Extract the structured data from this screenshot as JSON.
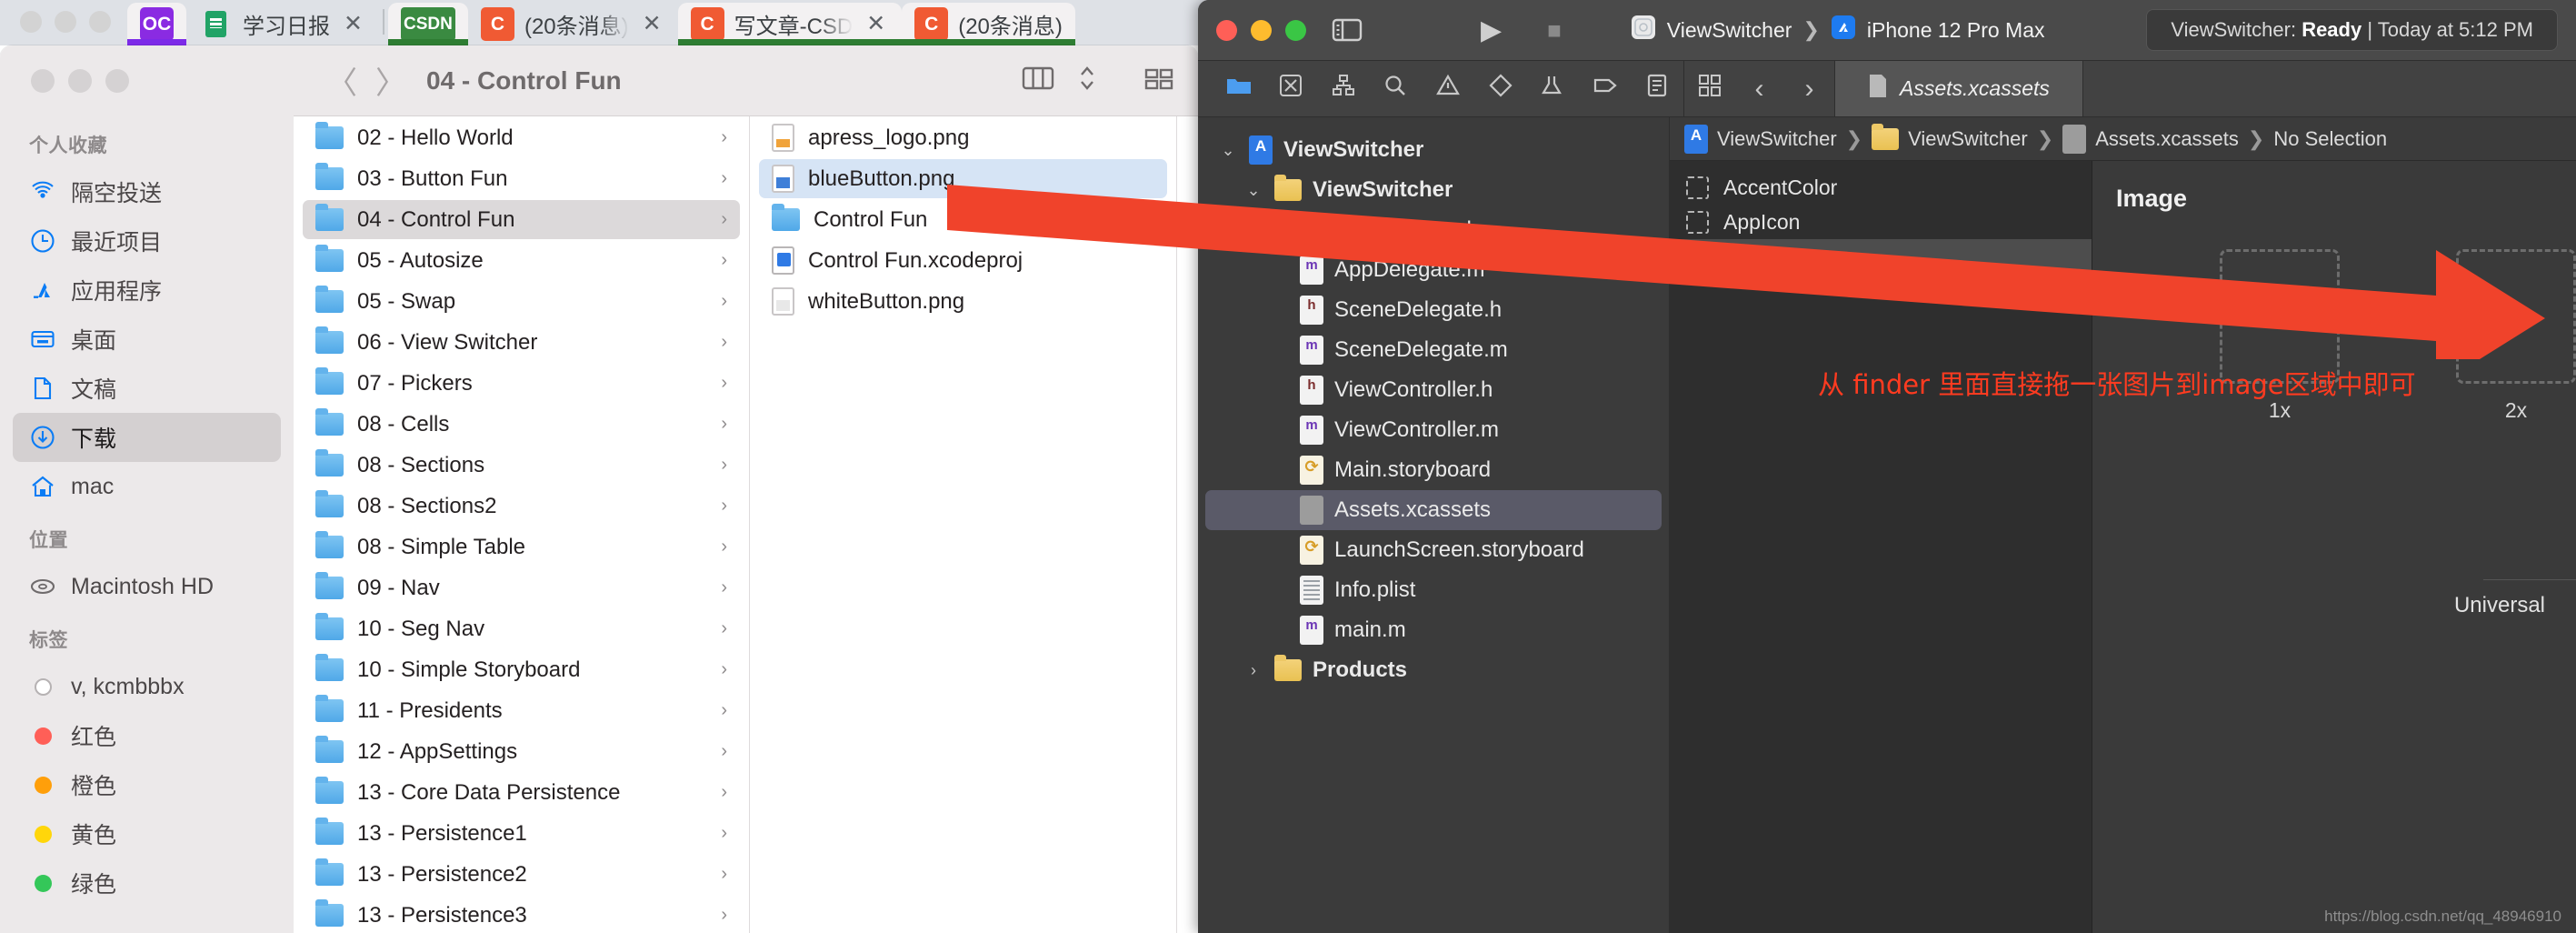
{
  "browser": {
    "window_dots": [
      "dot-red",
      "dot-yellow",
      "dot-green"
    ],
    "tabs": [
      {
        "favicon_text": "OC",
        "favicon_color": "#8a2be2",
        "title": "",
        "accent": "#7c2ae8",
        "active": true,
        "closable": false
      },
      {
        "favicon_text": "",
        "favicon_color": "#21a366",
        "title": "学习日报",
        "accent": "",
        "active": false,
        "closable": true
      },
      {
        "favicon_text": "CSDN",
        "favicon_color": "#3a8a41",
        "title": "",
        "accent": "#2e7d33",
        "active": true,
        "closable": false
      },
      {
        "favicon_text": "C",
        "favicon_color": "#f05a33",
        "title": "(20条消息)",
        "accent": "",
        "active": false,
        "closable": true
      },
      {
        "favicon_text": "C",
        "favicon_color": "#f05a33",
        "title": "写文章-CSD",
        "accent": "#2e7d33",
        "active": true,
        "closable": true
      },
      {
        "favicon_text": "C",
        "favicon_color": "#f05a33",
        "title": "(20条消息)",
        "accent": "#2e7d33",
        "active": false,
        "closable": false
      }
    ],
    "close_glyph": "✕"
  },
  "finder": {
    "title": "04 - Control Fun",
    "nav_back": "〈",
    "nav_forward": "〉",
    "view_icon": "column-view-icon",
    "sort_icon": "sort-icon",
    "grid_icon": "grid-view-icon",
    "sidebar": [
      {
        "type": "group",
        "label": "个人收藏"
      },
      {
        "type": "item",
        "label": "隔空投送",
        "icon": "airdrop-icon",
        "selected": false
      },
      {
        "type": "item",
        "label": "最近项目",
        "icon": "clock-icon",
        "selected": false
      },
      {
        "type": "item",
        "label": "应用程序",
        "icon": "appstore-icon",
        "selected": false
      },
      {
        "type": "item",
        "label": "桌面",
        "icon": "desktop-icon",
        "selected": false
      },
      {
        "type": "item",
        "label": "文稿",
        "icon": "document-icon",
        "selected": false
      },
      {
        "type": "item",
        "label": "下载",
        "icon": "download-icon",
        "selected": true
      },
      {
        "type": "item",
        "label": "mac",
        "icon": "home-icon",
        "selected": false
      },
      {
        "type": "group",
        "label": "位置"
      },
      {
        "type": "item",
        "label": "Macintosh HD",
        "icon": "harddisk-icon",
        "selected": false
      },
      {
        "type": "group",
        "label": "标签"
      },
      {
        "type": "tag",
        "label": "v, kcmbbbx",
        "color": "#ffffff",
        "selected": false
      },
      {
        "type": "tag",
        "label": "红色",
        "color": "#ff5f57",
        "selected": false
      },
      {
        "type": "tag",
        "label": "橙色",
        "color": "#ff9f0a",
        "selected": false
      },
      {
        "type": "tag",
        "label": "黄色",
        "color": "#ffd60a",
        "selected": false
      },
      {
        "type": "tag",
        "label": "绿色",
        "color": "#34c759",
        "selected": false
      }
    ],
    "column1": [
      {
        "label": "02 - Hello World",
        "kind": "folder",
        "selected": false,
        "chevron": "›"
      },
      {
        "label": "03 - Button Fun",
        "kind": "folder",
        "selected": false,
        "chevron": "›"
      },
      {
        "label": "04 - Control Fun",
        "kind": "folder",
        "selected": true,
        "chevron": "›"
      },
      {
        "label": "05 - Autosize",
        "kind": "folder",
        "selected": false,
        "chevron": "›"
      },
      {
        "label": "05 - Swap",
        "kind": "folder",
        "selected": false,
        "chevron": "›"
      },
      {
        "label": "06 - View Switcher",
        "kind": "folder",
        "selected": false,
        "chevron": "›"
      },
      {
        "label": "07 - Pickers",
        "kind": "folder",
        "selected": false,
        "chevron": "›"
      },
      {
        "label": "08 - Cells",
        "kind": "folder",
        "selected": false,
        "chevron": "›"
      },
      {
        "label": "08 - Sections",
        "kind": "folder",
        "selected": false,
        "chevron": "›"
      },
      {
        "label": "08 - Sections2",
        "kind": "folder",
        "selected": false,
        "chevron": "›"
      },
      {
        "label": "08 - Simple Table",
        "kind": "folder",
        "selected": false,
        "chevron": "›"
      },
      {
        "label": "09 - Nav",
        "kind": "folder",
        "selected": false,
        "chevron": "›"
      },
      {
        "label": "10 - Seg Nav",
        "kind": "folder",
        "selected": false,
        "chevron": "›"
      },
      {
        "label": "10 - Simple Storyboard",
        "kind": "folder",
        "selected": false,
        "chevron": "›"
      },
      {
        "label": "11 - Presidents",
        "kind": "folder",
        "selected": false,
        "chevron": "›"
      },
      {
        "label": "12 - AppSettings",
        "kind": "folder",
        "selected": false,
        "chevron": "›"
      },
      {
        "label": "13 - Core Data Persistence",
        "kind": "folder",
        "selected": false,
        "chevron": "›"
      },
      {
        "label": "13 - Persistence1",
        "kind": "folder",
        "selected": false,
        "chevron": "›"
      },
      {
        "label": "13 - Persistence2",
        "kind": "folder",
        "selected": false,
        "chevron": "›"
      },
      {
        "label": "13 - Persistence3",
        "kind": "folder",
        "selected": false,
        "chevron": "›"
      }
    ],
    "column2": [
      {
        "label": "apress_logo.png",
        "kind": "png",
        "selected": false,
        "chevron": ""
      },
      {
        "label": "blueButton.png",
        "kind": "png-blue",
        "selected": true,
        "chevron": ""
      },
      {
        "label": "Control Fun",
        "kind": "folder",
        "selected": false,
        "chevron": "›"
      },
      {
        "label": "Control Fun.xcodeproj",
        "kind": "xcodeproj",
        "selected": false,
        "chevron": ""
      },
      {
        "label": "whiteButton.png",
        "kind": "png-white",
        "selected": false,
        "chevron": ""
      }
    ]
  },
  "xcode": {
    "window_dots": [
      "close",
      "minimize",
      "zoom"
    ],
    "sidebar_toggle_icon": "sidebar-toggle-icon",
    "run_icon": "▶",
    "stop_icon": "■",
    "scheme": {
      "project_icon": "app-icon",
      "project": "ViewSwitcher",
      "separator": "❯",
      "device_icon": "simulator-icon",
      "device": "iPhone 12 Pro Max"
    },
    "status": {
      "prefix": "ViewSwitcher: ",
      "state": "Ready",
      "divider": " | ",
      "time": "Today at 5:12 PM"
    },
    "navigator_icons": [
      "folder-icon",
      "warning-square-icon",
      "hierarchy-icon",
      "search-icon",
      "warning-triangle-icon",
      "issue-icon",
      "test-icon",
      "tag-icon",
      "report-icon"
    ],
    "editor_tabs": {
      "grid_icon": "grid-icon",
      "back": "‹",
      "forward": "›",
      "file_icon": "assets-icon",
      "file_label": "Assets.xcassets"
    },
    "navigator": [
      {
        "label": "ViewSwitcher",
        "icon": "xcode-project-icon",
        "indent": 0,
        "disclosure": "⌄",
        "selected": false
      },
      {
        "label": "ViewSwitcher",
        "icon": "folder-icon",
        "indent": 1,
        "disclosure": "⌄",
        "selected": false
      },
      {
        "label": "AppDelegate.h",
        "icon": "header-file-icon",
        "indent": 2,
        "disclosure": "",
        "selected": false
      },
      {
        "label": "AppDelegate.m",
        "icon": "objc-file-icon",
        "indent": 2,
        "disclosure": "",
        "selected": false
      },
      {
        "label": "SceneDelegate.h",
        "icon": "header-file-icon",
        "indent": 2,
        "disclosure": "",
        "selected": false
      },
      {
        "label": "SceneDelegate.m",
        "icon": "objc-file-icon",
        "indent": 2,
        "disclosure": "",
        "selected": false
      },
      {
        "label": "ViewController.h",
        "icon": "header-file-icon",
        "indent": 2,
        "disclosure": "",
        "selected": false
      },
      {
        "label": "ViewController.m",
        "icon": "objc-file-icon",
        "indent": 2,
        "disclosure": "",
        "selected": false
      },
      {
        "label": "Main.storyboard",
        "icon": "storyboard-icon",
        "indent": 2,
        "disclosure": "",
        "selected": false
      },
      {
        "label": "Assets.xcassets",
        "icon": "assets-icon",
        "indent": 2,
        "disclosure": "",
        "selected": true
      },
      {
        "label": "LaunchScreen.storyboard",
        "icon": "storyboard-icon",
        "indent": 2,
        "disclosure": "",
        "selected": false
      },
      {
        "label": "Info.plist",
        "icon": "plist-icon",
        "indent": 2,
        "disclosure": "",
        "selected": false
      },
      {
        "label": "main.m",
        "icon": "objc-file-icon",
        "indent": 2,
        "disclosure": "",
        "selected": false
      },
      {
        "label": "Products",
        "icon": "folder-icon",
        "indent": 1,
        "disclosure": "›",
        "selected": false
      }
    ],
    "breadcrumb": [
      {
        "label": "ViewSwitcher",
        "icon": "xcode-project-icon"
      },
      {
        "label": "ViewSwitcher",
        "icon": "folder-icon"
      },
      {
        "label": "Assets.xcassets",
        "icon": "assets-icon"
      },
      {
        "label": "No Selection",
        "icon": ""
      }
    ],
    "breadcrumb_sep": "❯",
    "asset_list": [
      {
        "label": "AccentColor",
        "selected": false
      },
      {
        "label": "AppIcon",
        "selected": false
      },
      {
        "label": "Image",
        "selected": true
      }
    ],
    "asset_detail": {
      "title": "Image",
      "slots": [
        {
          "label": "1x"
        },
        {
          "label": "2x"
        }
      ],
      "footer": "Universal"
    }
  },
  "annotation": {
    "text": "从 finder 里面直接拖一张图片到image区域中即可",
    "color": "#ff3b20",
    "arrow_color": "#f0432b"
  },
  "watermark": "https://blog.csdn.net/qq_48946910"
}
